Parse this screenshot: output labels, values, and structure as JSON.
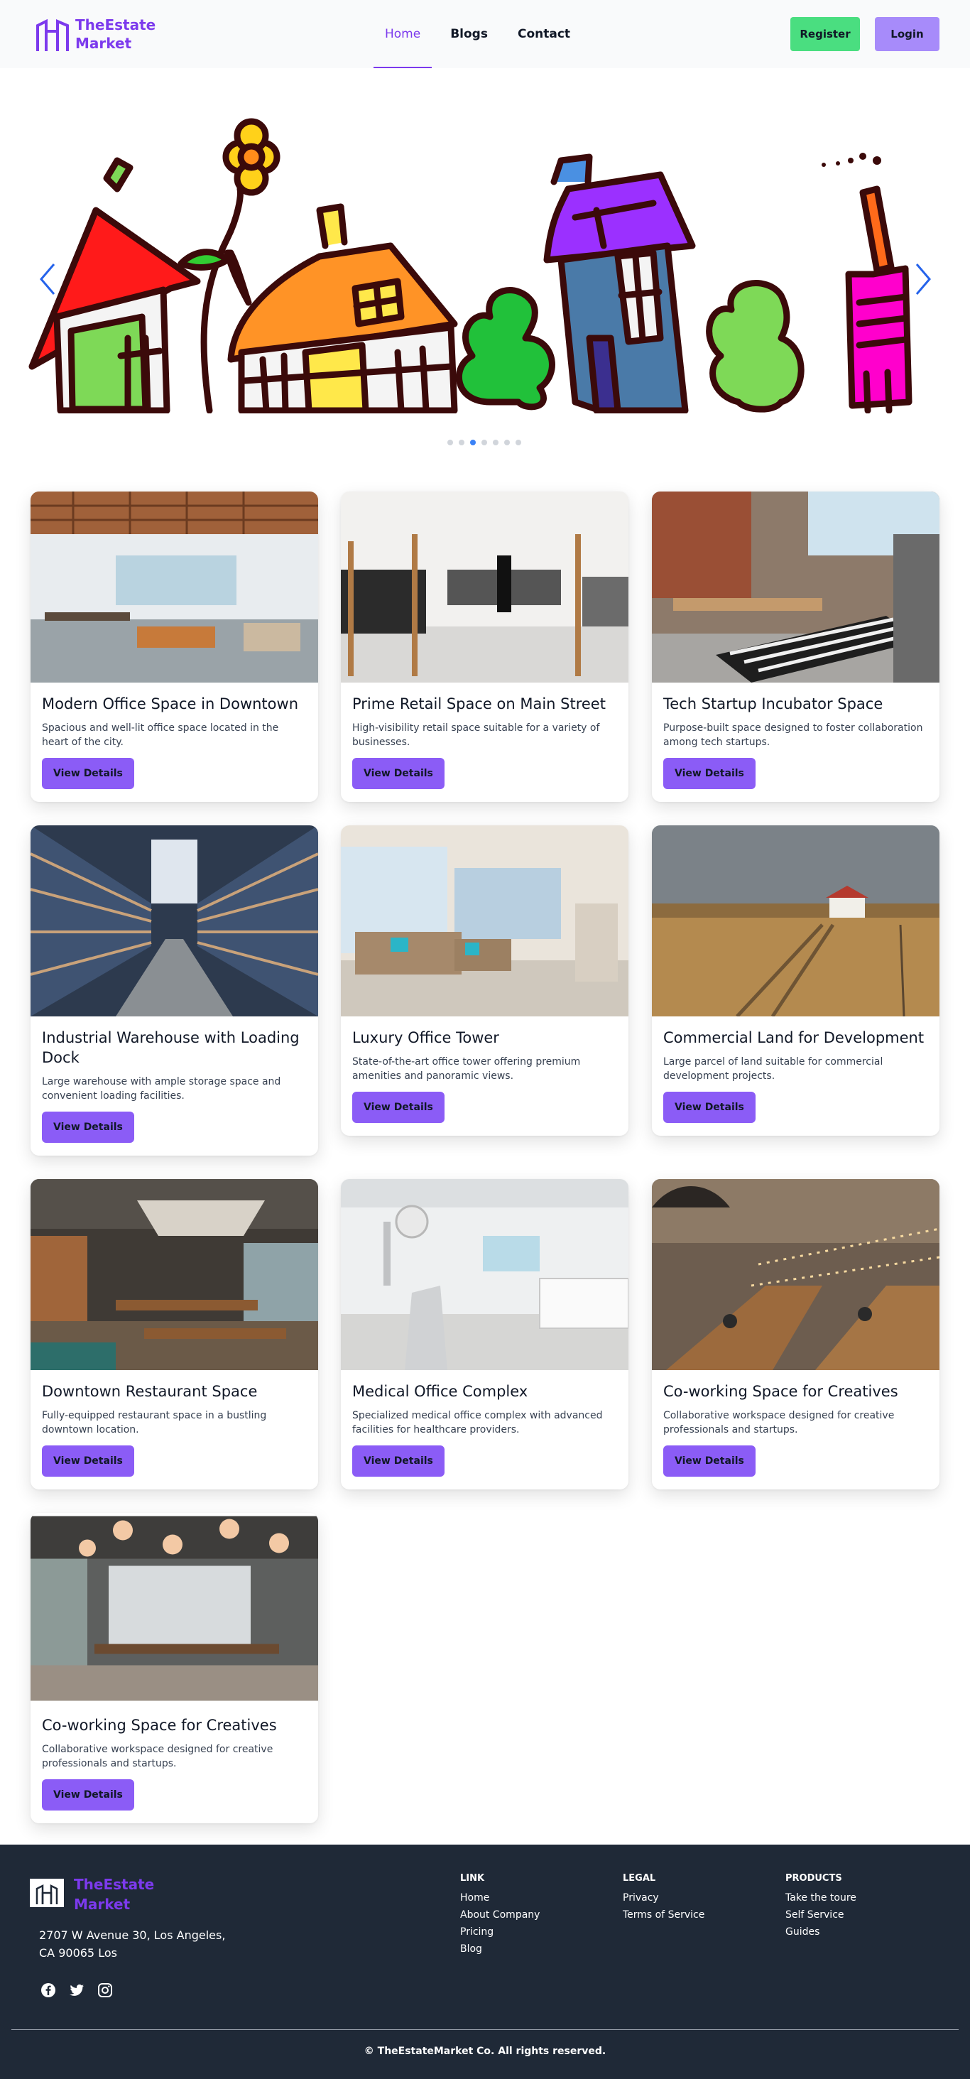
{
  "brand": {
    "line1": "TheEstate",
    "line2": "Market"
  },
  "nav": {
    "home": "Home",
    "blogs": "Blogs",
    "contact": "Contact",
    "register": "Register",
    "login": "Login"
  },
  "carousel": {
    "slides": 7,
    "active_index": 2
  },
  "listings": [
    {
      "title": "Modern Office Space in Downtown",
      "desc": "Spacious and well-lit office space located in the heart of the city.",
      "btn": "View Details",
      "image": "office-interior"
    },
    {
      "title": "Prime Retail Space on Main Street",
      "desc": "High-visibility retail space suitable for a variety of businesses.",
      "btn": "View Details",
      "image": "retail-store"
    },
    {
      "title": "Tech Startup Incubator Space",
      "desc": "Purpose-built space designed to foster collaboration among tech startups.",
      "btn": "View Details",
      "image": "startup-loft"
    },
    {
      "title": "Industrial Warehouse with Loading Dock",
      "desc": "Large warehouse with ample storage space and convenient loading facilities.",
      "btn": "View Details",
      "image": "warehouse-aisle"
    },
    {
      "title": "Luxury Office Tower",
      "desc": "State-of-the-art office tower offering premium amenities and panoramic views.",
      "btn": "View Details",
      "image": "lounge-room"
    },
    {
      "title": "Commercial Land for Development",
      "desc": "Large parcel of land suitable for commercial development projects.",
      "btn": "View Details",
      "image": "open-field"
    },
    {
      "title": "Downtown Restaurant Space",
      "desc": "Fully-equipped restaurant space in a bustling downtown location.",
      "btn": "View Details",
      "image": "restaurant-hall"
    },
    {
      "title": "Medical Office Complex",
      "desc": "Specialized medical office complex with advanced facilities for healthcare providers.",
      "btn": "View Details",
      "image": "dental-clinic"
    },
    {
      "title": "Co-working Space for Creatives",
      "desc": "Collaborative workspace designed for creative professionals and startups.",
      "btn": "View Details",
      "image": "coworking-hall"
    },
    {
      "title": "Co-working Space for Creatives",
      "desc": "Collaborative workspace designed for creative professionals and startups.",
      "btn": "View Details",
      "image": "dining-lounge"
    }
  ],
  "footer": {
    "brand_line1": "TheEstate",
    "brand_line2": "Market",
    "address": "2707 W Avenue 30, Los Angeles, CA 90065 Los",
    "link_title": "LINK",
    "links": [
      "Home",
      "About Company",
      "Pricing",
      "Blog"
    ],
    "legal_title": "LEGAL",
    "legal": [
      "Privacy",
      "Terms of Service"
    ],
    "products_title": "PRODUCTS",
    "products": [
      "Take the toure",
      "Self Service",
      "Guides"
    ],
    "copyright": "© TheEstateMarket Co. All rights reserved."
  },
  "colors": {
    "brand": "#7c3aed",
    "register": "#4ade80",
    "login": "#a78bfa",
    "card_button": "#8b5cf6",
    "footer_bg": "#1f2937"
  }
}
